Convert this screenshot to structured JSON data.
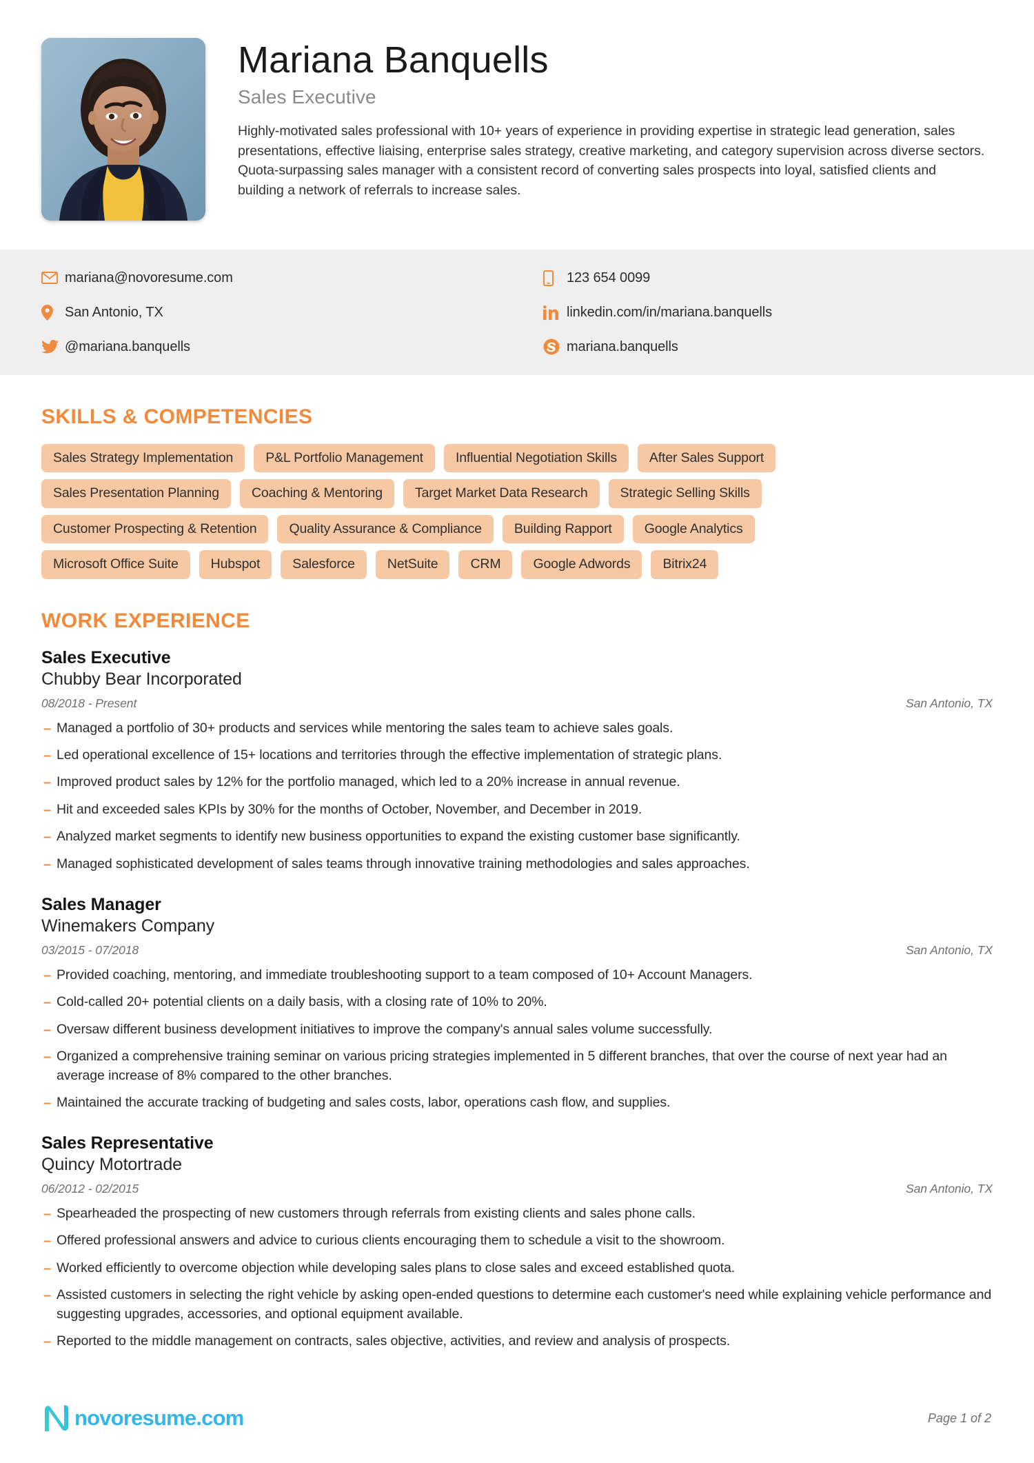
{
  "profile": {
    "name": "Mariana Banquells",
    "title": "Sales Executive",
    "summary": "Highly-motivated sales professional with 10+ years of experience in providing expertise in strategic lead generation, sales presentations, effective liaising, enterprise sales strategy, creative marketing, and category supervision across diverse sectors. Quota-surpassing sales manager with a consistent record of converting sales prospects into loyal, satisfied clients and building a network of referrals to increase sales."
  },
  "contact": {
    "left": [
      {
        "icon": "email-icon",
        "value": "mariana@novoresume.com"
      },
      {
        "icon": "location-pin-icon",
        "value": "San Antonio, TX"
      },
      {
        "icon": "twitter-icon",
        "value": "@mariana.banquells"
      }
    ],
    "right": [
      {
        "icon": "phone-icon",
        "value": "123 654 0099"
      },
      {
        "icon": "linkedin-icon",
        "value": "linkedin.com/in/mariana.banquells"
      },
      {
        "icon": "skype-icon",
        "value": "mariana.banquells"
      }
    ]
  },
  "skills": {
    "heading": "SKILLS & COMPETENCIES",
    "rows": [
      [
        "Sales Strategy Implementation",
        "P&L Portfolio Management",
        "Influential Negotiation Skills",
        "After Sales Support"
      ],
      [
        "Sales Presentation Planning",
        "Coaching & Mentoring",
        "Target Market Data Research",
        "Strategic Selling Skills"
      ],
      [
        "Customer Prospecting & Retention",
        "Quality Assurance & Compliance",
        "Building Rapport",
        "Google Analytics"
      ],
      [
        "Microsoft Office Suite",
        "Hubspot",
        "Salesforce",
        "NetSuite",
        "CRM",
        "Google Adwords",
        "Bitrix24"
      ]
    ]
  },
  "work": {
    "heading": "WORK EXPERIENCE",
    "jobs": [
      {
        "role": "Sales Executive",
        "company": "Chubby Bear Incorporated",
        "dates": "08/2018 - Present",
        "location": "San Antonio, TX",
        "bullets": [
          "Managed a portfolio of 30+ products and services while mentoring the sales team to achieve sales goals.",
          "Led operational excellence of 15+ locations and territories through the effective implementation of strategic plans.",
          "Improved product sales by 12% for the portfolio managed, which led to a 20% increase in annual revenue.",
          "Hit and exceeded sales KPIs by 30% for the months of October, November, and December in 2019.",
          "Analyzed market segments to identify new business opportunities to expand the existing customer base significantly.",
          "Managed sophisticated development of sales teams through innovative training methodologies and sales approaches."
        ]
      },
      {
        "role": "Sales Manager",
        "company": "Winemakers Company",
        "dates": "03/2015 - 07/2018",
        "location": "San Antonio, TX",
        "bullets": [
          "Provided coaching, mentoring, and immediate troubleshooting support to a team composed of 10+ Account Managers.",
          "Cold-called 20+ potential clients on a daily basis, with a closing rate of 10% to 20%.",
          "Oversaw different business development initiatives to improve the company's annual sales volume successfully.",
          "Organized a comprehensive training seminar on various pricing strategies implemented in 5 different branches, that over the course of next year had an average increase of 8% compared to the other branches.",
          "Maintained the accurate tracking of budgeting and sales costs, labor, operations cash flow, and supplies."
        ]
      },
      {
        "role": "Sales Representative",
        "company": "Quincy Motortrade",
        "dates": "06/2012 - 02/2015",
        "location": "San Antonio, TX",
        "bullets": [
          "Spearheaded the prospecting of new customers through referrals from existing clients and sales phone calls.",
          "Offered professional answers and advice to curious clients encouraging them to schedule a visit to the showroom.",
          "Worked efficiently to overcome objection while developing sales plans to close sales and exceed established quota.",
          "Assisted customers in selecting the right vehicle by asking open-ended questions to determine each customer's need while explaining vehicle performance and suggesting upgrades, accessories, and optional equipment available.",
          "Reported to the middle management on contracts, sales objective, activities, and review and analysis of prospects."
        ]
      }
    ]
  },
  "footer": {
    "logo_text": "novoresume.com",
    "page_number": "Page 1 of 2"
  },
  "colors": {
    "accent": "#f08a3c",
    "tag_bg": "#f6c9a4",
    "contact_bar_bg": "#efefef",
    "logo_blue": "#35b6e8",
    "logo_teal": "#3fd0c9"
  }
}
